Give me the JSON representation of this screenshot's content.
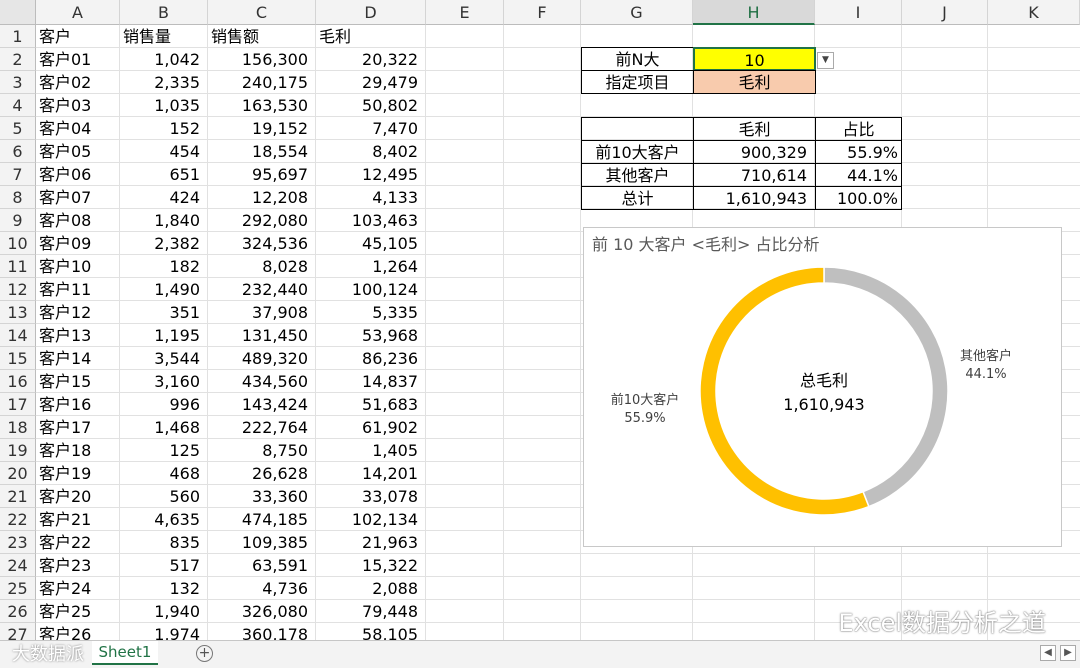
{
  "columns": [
    "A",
    "B",
    "C",
    "D",
    "E",
    "F",
    "G",
    "H",
    "I",
    "J",
    "K"
  ],
  "selected_column": "H",
  "rows": [
    "1",
    "2",
    "3",
    "4",
    "5",
    "6",
    "7",
    "8",
    "9",
    "10",
    "11",
    "12",
    "13",
    "14",
    "15",
    "16",
    "17",
    "18",
    "19",
    "20",
    "21",
    "22",
    "23",
    "24",
    "25",
    "26",
    "27"
  ],
  "table": {
    "headers": [
      "客户",
      "销售量",
      "销售额",
      "毛利"
    ],
    "data": [
      [
        "客户01",
        "1,042",
        "156,300",
        "20,322"
      ],
      [
        "客户02",
        "2,335",
        "240,175",
        "29,479"
      ],
      [
        "客户03",
        "1,035",
        "163,530",
        "50,802"
      ],
      [
        "客户04",
        "152",
        "19,152",
        "7,470"
      ],
      [
        "客户05",
        "454",
        "18,554",
        "8,402"
      ],
      [
        "客户06",
        "651",
        "95,697",
        "12,495"
      ],
      [
        "客户07",
        "424",
        "12,208",
        "4,133"
      ],
      [
        "客户08",
        "1,840",
        "292,080",
        "103,463"
      ],
      [
        "客户09",
        "2,382",
        "324,536",
        "45,105"
      ],
      [
        "客户10",
        "182",
        "8,028",
        "1,264"
      ],
      [
        "客户11",
        "1,490",
        "232,440",
        "100,124"
      ],
      [
        "客户12",
        "351",
        "37,908",
        "5,335"
      ],
      [
        "客户13",
        "1,195",
        "131,450",
        "53,968"
      ],
      [
        "客户14",
        "3,544",
        "489,320",
        "86,236"
      ],
      [
        "客户15",
        "3,160",
        "434,560",
        "14,837"
      ],
      [
        "客户16",
        "996",
        "143,424",
        "51,683"
      ],
      [
        "客户17",
        "1,468",
        "222,764",
        "61,902"
      ],
      [
        "客户18",
        "125",
        "8,750",
        "1,405"
      ],
      [
        "客户19",
        "468",
        "26,628",
        "14,201"
      ],
      [
        "客户20",
        "560",
        "33,360",
        "33,078"
      ],
      [
        "客户21",
        "4,635",
        "474,185",
        "102,134"
      ],
      [
        "客户22",
        "835",
        "109,385",
        "21,963"
      ],
      [
        "客户23",
        "517",
        "63,591",
        "15,322"
      ],
      [
        "客户24",
        "132",
        "4,736",
        "2,088"
      ],
      [
        "客户25",
        "1,940",
        "326,080",
        "79,448"
      ],
      [
        "客户26",
        "1,974",
        "360,178",
        "58,105"
      ]
    ]
  },
  "controls": {
    "topn_label": "前N大",
    "topn_value": "10",
    "item_label": "指定项目",
    "item_value": "毛利",
    "topn_color": "#ffff00",
    "item_color": "#f8cbad"
  },
  "summary": {
    "headers": [
      "毛利",
      "占比"
    ],
    "rows": [
      {
        "label": "前10大客户",
        "value": "900,329",
        "pct": "55.9%"
      },
      {
        "label": "其他客户",
        "value": "710,614",
        "pct": "44.1%"
      },
      {
        "label": "总计",
        "value": "1,610,943",
        "pct": "100.0%"
      }
    ]
  },
  "chart_data": {
    "type": "pie",
    "title": "前 10 大客户 <毛利> 占比分析",
    "center_label": "总毛利",
    "center_value": "1,610,943",
    "slices": [
      {
        "name": "其他客户",
        "value": 710614,
        "pct": "44.1%",
        "color": "#bfbfbf"
      },
      {
        "name": "前10大客户",
        "value": 900329,
        "pct": "55.9%",
        "color": "#ffc000"
      }
    ]
  },
  "sheet_tab": "Sheet1",
  "watermark": "Excel数据分析之道",
  "watermark_left": "大数据派"
}
